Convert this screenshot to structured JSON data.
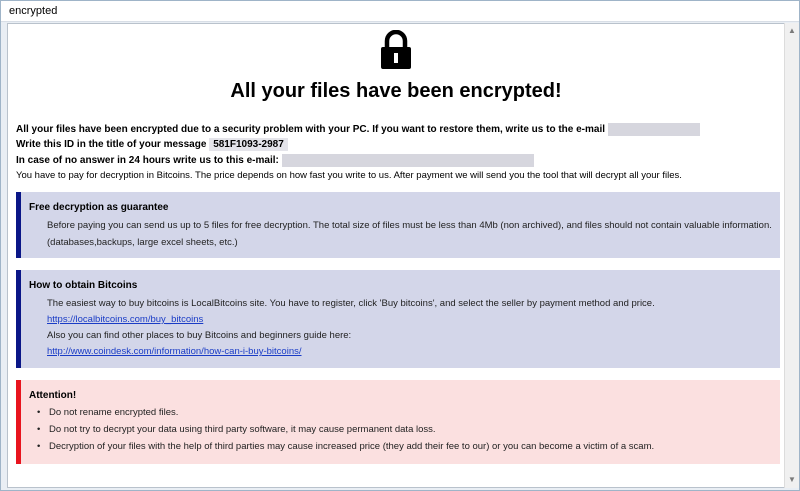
{
  "window": {
    "title": "encrypted"
  },
  "header": {
    "headline": "All your files have been encrypted!",
    "lock_icon": "padlock-icon"
  },
  "intro": {
    "line1": "All your files have been encrypted due to a security problem with your PC. If you want to restore them, write us to the e-mail",
    "line2_prefix": "Write this ID in the title of your message",
    "id_value": "581F1093-2987",
    "line3": "In case of no answer in 24 hours write us to this e-mail:",
    "line4": "You have to pay for decryption in Bitcoins. The price depends on how fast you write to us. After payment we will send you the tool that will decrypt all your files."
  },
  "free_decryption": {
    "title": "Free decryption as guarantee",
    "text1": "Before paying you can send us up to 5 files for free decryption. The total size of files must be less than 4Mb (non archived), and files should not contain valuable information.",
    "text2": "(databases,backups, large excel sheets, etc.)"
  },
  "bitcoins": {
    "title": "How to obtain Bitcoins",
    "text1": "The easiest way to buy bitcoins is LocalBitcoins site. You have to register, click 'Buy bitcoins', and select the seller by payment method and price.",
    "link1": "https://localbitcoins.com/buy_bitcoins",
    "text2": "Also you can find other places to buy Bitcoins and beginners guide here:",
    "link2": "http://www.coindesk.com/information/how-can-i-buy-bitcoins/"
  },
  "attention": {
    "title": "Attention!",
    "items": [
      "Do not rename encrypted files.",
      "Do not try to decrypt your data using third party software, it may cause permanent data loss.",
      "Decryption of your files with the help of third parties may cause increased price (they add their fee to our) or you can become a victim of a scam."
    ]
  },
  "colors": {
    "blue_accent": "#0a1687",
    "red_accent": "#e8141e",
    "blue_panel": "#d3d6e9",
    "red_panel": "#fbe0e0"
  }
}
